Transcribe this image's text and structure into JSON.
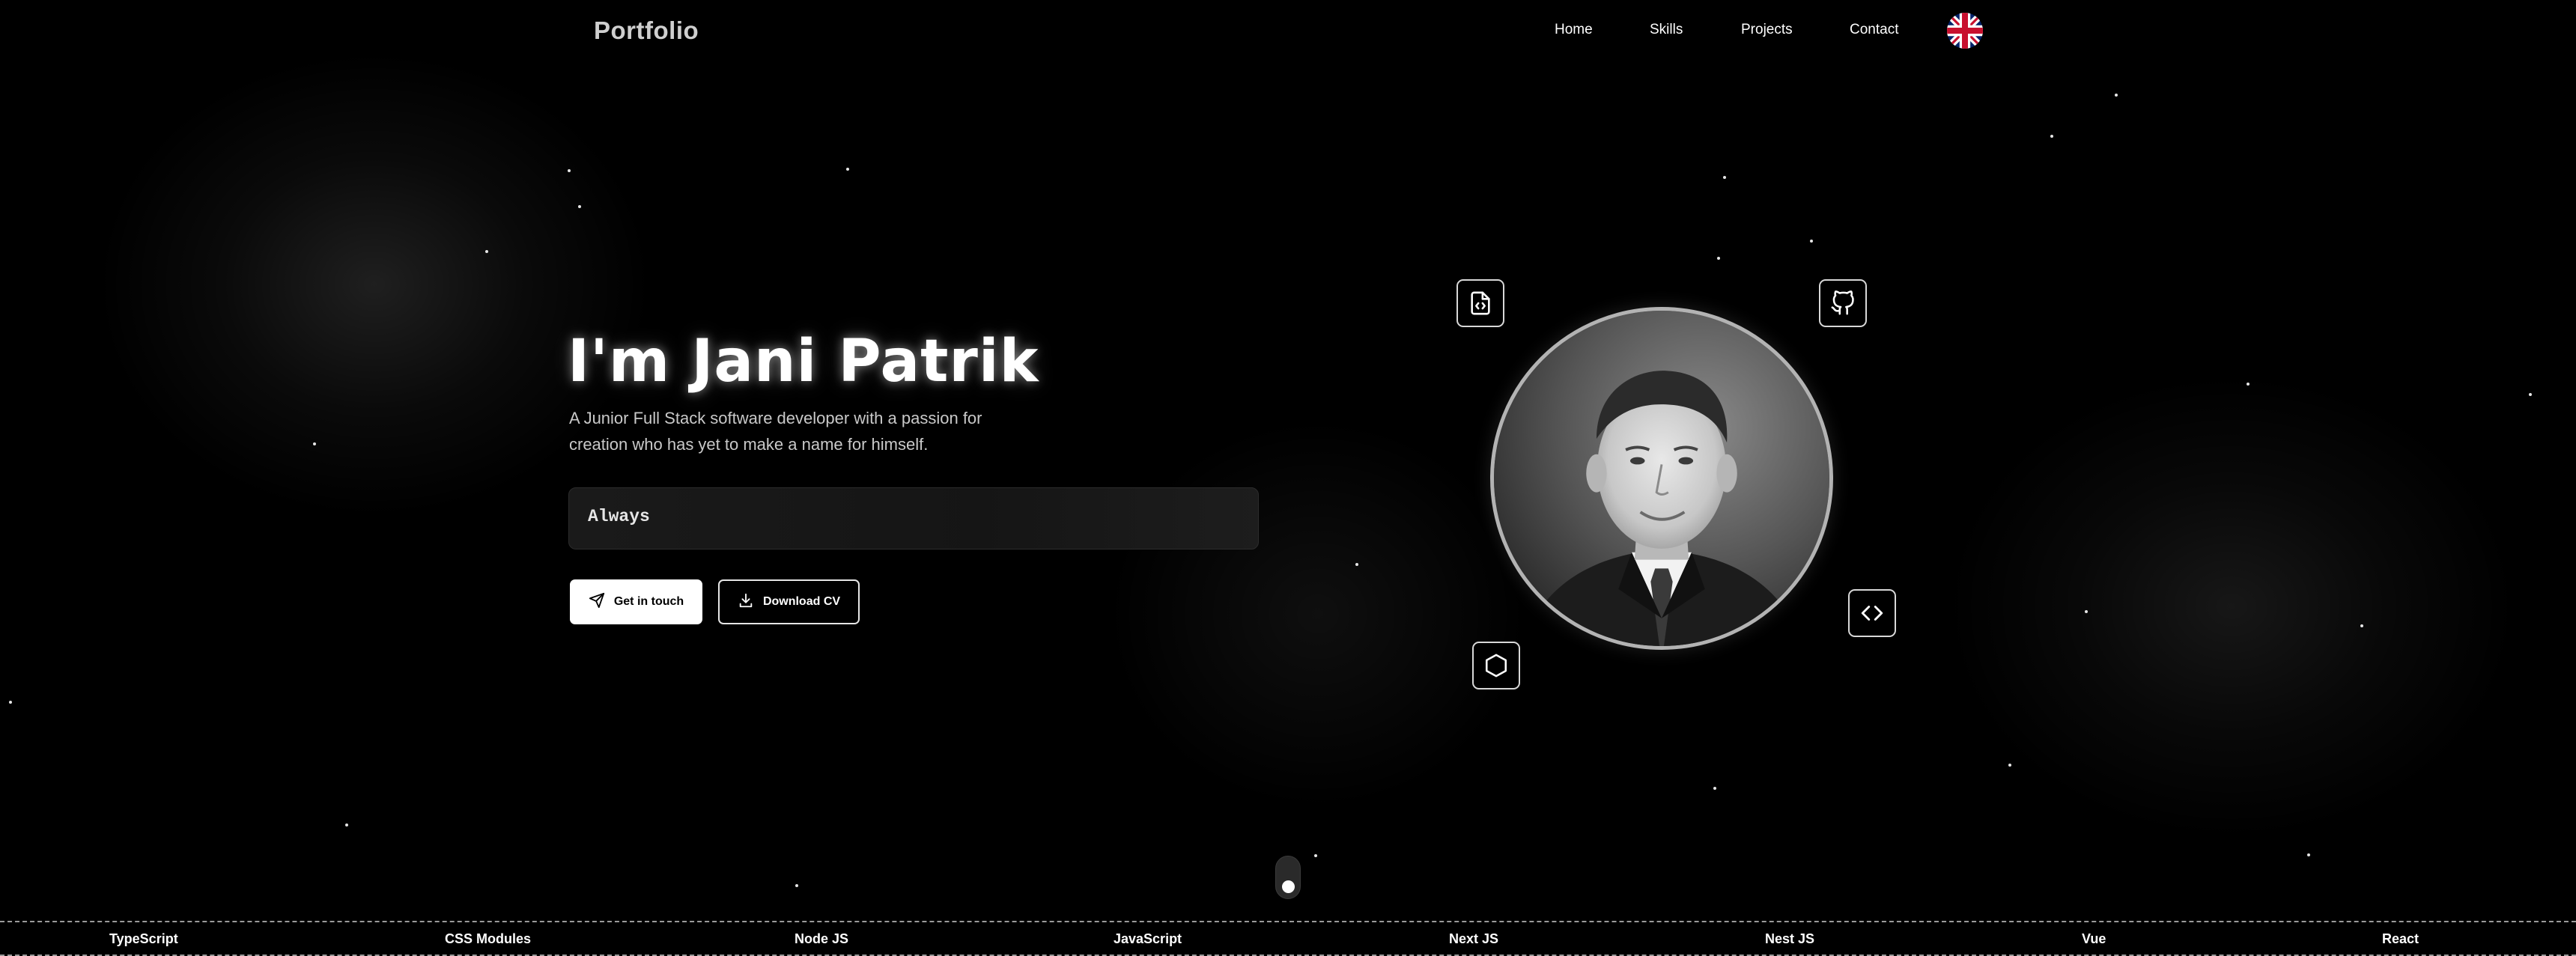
{
  "nav": {
    "brand": "Portfolio",
    "links": [
      {
        "label": "Home"
      },
      {
        "label": "Skills"
      },
      {
        "label": "Projects"
      },
      {
        "label": "Contact"
      }
    ],
    "language_icon": "uk-flag-icon"
  },
  "hero": {
    "title": "I'm Jani Patrik",
    "subtitle": "A Junior Full Stack software developer with a passion for creation who has yet to make a name for himself.",
    "typewriter_text": "Always",
    "primary_button": {
      "label": "Get in touch",
      "icon": "send-icon"
    },
    "secondary_button": {
      "label": "Download CV",
      "icon": "download-icon"
    }
  },
  "portrait": {
    "floating_icons": [
      "file-code-icon",
      "github-icon",
      "hexagon-icon",
      "code-brackets-icon"
    ]
  },
  "scroll_indicator": {
    "icon": "scroll-mouse-icon"
  },
  "skills_ticker": [
    "TypeScript",
    "CSS Modules",
    "Node JS",
    "JavaScript",
    "Next JS",
    "Nest JS",
    "Vue",
    "React"
  ],
  "colors": {
    "background": "#000000",
    "text": "#ffffff",
    "muted_text": "#c9c9c9",
    "brand_text": "#cfcfcf",
    "portrait_ring": "#b3b3b3"
  }
}
